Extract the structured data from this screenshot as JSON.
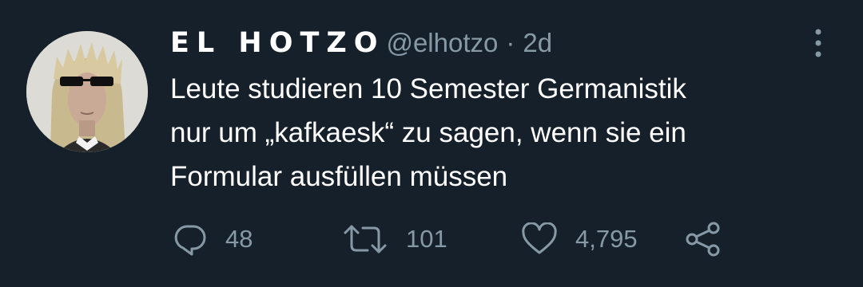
{
  "tweet": {
    "display_name": "EL HOTZO",
    "handle": "@elhotzo",
    "separator": "·",
    "time": "2d",
    "text_lines": [
      "Leute studieren 10 Semester Germanistik",
      "nur um „kafkaesk“ zu sagen, wenn sie ein",
      "Formular ausfüllen müssen"
    ]
  },
  "actions": {
    "reply_count": "48",
    "retweet_count": "101",
    "like_count": "4,795"
  },
  "icons": {
    "more": "more-vertical-icon",
    "reply": "reply-icon",
    "retweet": "retweet-icon",
    "like": "heart-icon",
    "share": "share-icon"
  },
  "colors": {
    "background": "#15202b",
    "text": "#ffffff",
    "secondary": "#8899a6"
  }
}
